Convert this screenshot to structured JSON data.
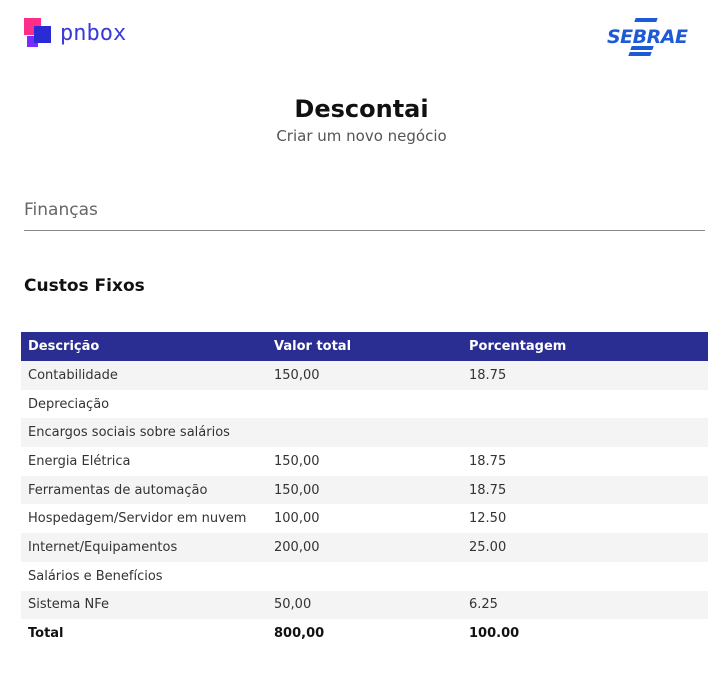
{
  "header": {
    "left_logo_text": "pnbox",
    "right_logo_text": "SEBRAE"
  },
  "title": "Descontai",
  "subtitle": "Criar um novo negócio",
  "section_label": "Finanças",
  "table_title": "Custos Fixos",
  "table": {
    "columns": [
      "Descrição",
      "Valor total",
      "Porcentagem"
    ],
    "rows": [
      [
        "Contabilidade",
        "150,00",
        "18.75"
      ],
      [
        "Depreciação",
        "",
        ""
      ],
      [
        "Encargos sociais sobre salários",
        "",
        ""
      ],
      [
        "Energia Elétrica",
        "150,00",
        "18.75"
      ],
      [
        "Ferramentas de automação",
        "150,00",
        "18.75"
      ],
      [
        "Hospedagem/Servidor em nuvem",
        "100,00",
        "12.50"
      ],
      [
        "Internet/Equipamentos",
        "200,00",
        "25.00"
      ],
      [
        "Salários e Benefícios",
        "",
        ""
      ],
      [
        "Sistema NFe",
        "50,00",
        "6.25"
      ]
    ],
    "total": [
      "Total",
      "800,00",
      "100.00"
    ]
  },
  "colors": {
    "header_bg": "#2a2d92",
    "brand_blue": "#1f5ad6",
    "pnbox_pink": "#ff2d8a"
  }
}
